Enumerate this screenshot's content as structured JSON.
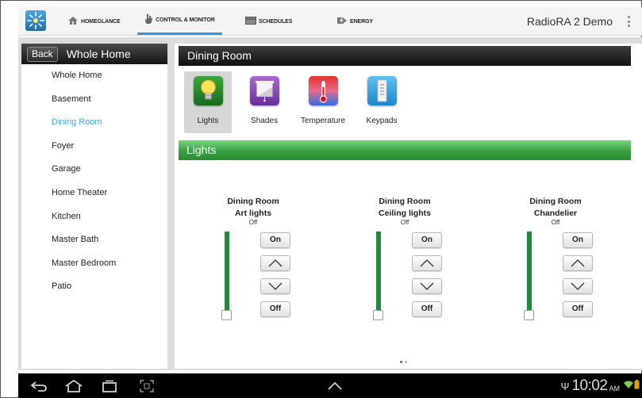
{
  "topbar": {
    "tabs": [
      {
        "label": "HOMEGLANCE",
        "icon": "home-icon"
      },
      {
        "label": "CONTROL & MONITOR",
        "icon": "hand-icon",
        "active": true
      },
      {
        "label": "SCHEDULES",
        "icon": "calendar-icon"
      },
      {
        "label": "ENERGY",
        "icon": "energy-icon"
      }
    ],
    "app_title": "RadioRA 2 Demo"
  },
  "sidebar": {
    "back_label": "Back",
    "title": "Whole Home",
    "rooms": [
      "Whole Home",
      "Basement",
      "Dining Room",
      "Foyer",
      "Garage",
      "Home Theater",
      "Kitchen",
      "Master Bath",
      "Master Bedroom",
      "Patio"
    ],
    "active_room": "Dining Room"
  },
  "main": {
    "room_title": "Dining Room",
    "categories": [
      {
        "label": "Lights",
        "icon": "bulb-icon",
        "selected": true
      },
      {
        "label": "Shades",
        "icon": "shade-icon"
      },
      {
        "label": "Temperature",
        "icon": "thermometer-icon"
      },
      {
        "label": "Keypads",
        "icon": "keypad-icon"
      }
    ],
    "section_title": "Lights",
    "zones": [
      {
        "name_line1": "Dining Room",
        "name_line2": "Art lights",
        "status": "Off",
        "level": 0,
        "on_label": "On",
        "off_label": "Off"
      },
      {
        "name_line1": "Dining Room",
        "name_line2": "Ceiling lights",
        "status": "Off",
        "level": 0,
        "on_label": "On",
        "off_label": "Off"
      },
      {
        "name_line1": "Dining Room",
        "name_line2": "Chandelier",
        "status": "Off",
        "level": 0,
        "on_label": "On",
        "off_label": "Off"
      }
    ],
    "page_count": 2,
    "current_page": 1
  },
  "statusbar": {
    "time": "10:02",
    "ampm": "AM"
  },
  "colors": {
    "accent_blue": "#3aa7d8",
    "slider_green": "#1f8a3a",
    "section_green": "#36a040"
  }
}
